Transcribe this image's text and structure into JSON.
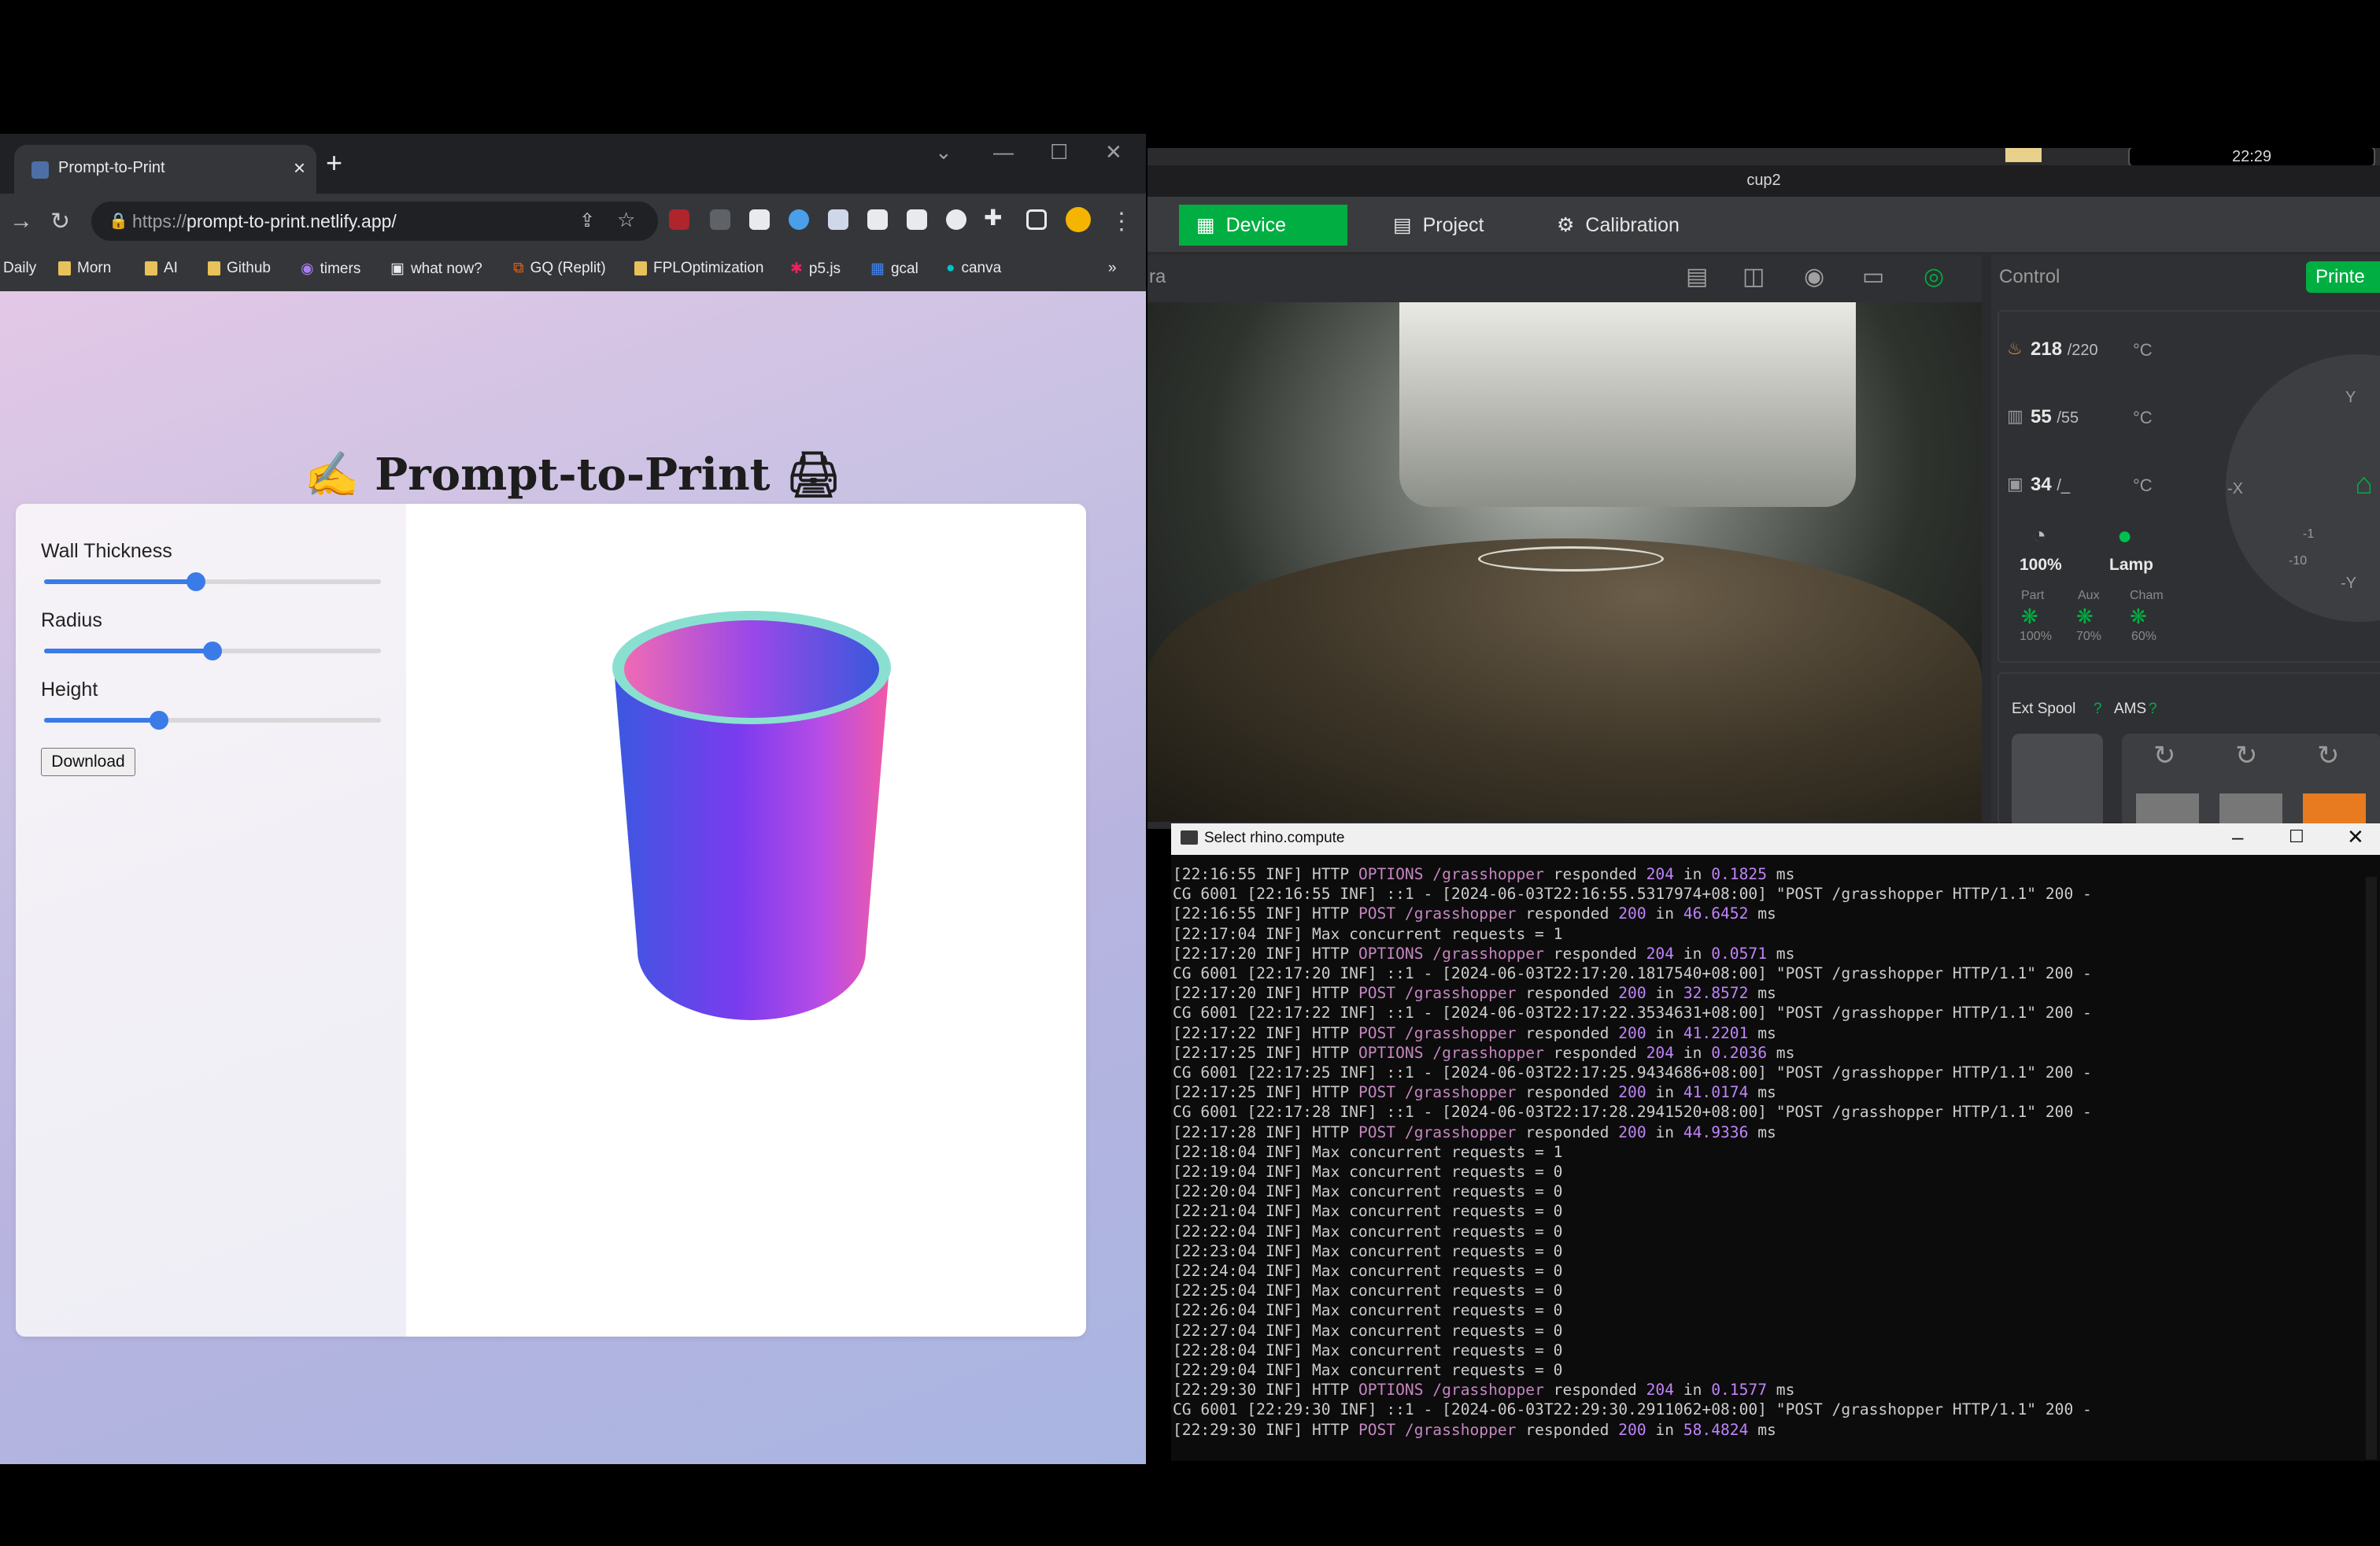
{
  "browser": {
    "tab_title": "Prompt-to-Print",
    "url_prefix": "https://",
    "url_host": "prompt-to-print.netlify.app/",
    "bookmarks": [
      {
        "label": "Daily"
      },
      {
        "label": "Morn"
      },
      {
        "label": "AI"
      },
      {
        "label": "Github"
      },
      {
        "label": "timers"
      },
      {
        "label": "what now?"
      },
      {
        "label": "GQ (Replit)"
      },
      {
        "label": "FPLOptimization"
      },
      {
        "label": "p5.js"
      },
      {
        "label": "gcal"
      },
      {
        "label": "canva"
      }
    ],
    "more": "»"
  },
  "app": {
    "title": "Prompt-to-Print",
    "title_icon_left": "✍",
    "title_icon_right": "🖨",
    "wall_thickness_label": "Wall Thickness",
    "wall_thickness_value": 0.45,
    "radius_label": "Radius",
    "radius_value": 0.5,
    "height_label": "Height",
    "height_value": 0.34,
    "download_label": "Download"
  },
  "bambu": {
    "window_title": "cup2",
    "clock": "22:29",
    "tabs": [
      {
        "label": "Device",
        "active": true
      },
      {
        "label": "Project",
        "active": false
      },
      {
        "label": "Calibration",
        "active": false
      }
    ],
    "camera_label": "ra",
    "control_label": "Control",
    "printer_button": "Printe",
    "nozzle_temp": "218",
    "nozzle_target": "/220",
    "bed_temp": "55",
    "bed_target": "/55",
    "chamber_temp": "34",
    "chamber_target": "/_",
    "temp_unit": "°C",
    "speed": "100%",
    "lamp": "Lamp",
    "fans": [
      {
        "label": "Part",
        "value": "100%"
      },
      {
        "label": "Aux",
        "value": "70%"
      },
      {
        "label": "Cham",
        "value": "60%"
      }
    ],
    "jog": {
      "y_plus": "Y",
      "x_minus": "-X",
      "y_minus": "-Y",
      "z": "-10",
      "z1": "-1"
    },
    "ext_spool": "Ext Spool",
    "ams": "AMS"
  },
  "terminal": {
    "title": "Select rhino.compute",
    "lines": [
      "[22:16:55 INF] HTTP |OPTIONS /grasshopper| responded |204| in |0.1825| ms",
      "CG 6001 [22:16:55 INF] ::1 - [2024-06-03T22:16:55.5317974+08:00] \"POST /grasshopper HTTP/1.1\" 200 -",
      "[22:16:55 INF] HTTP |POST /grasshopper| responded |200| in |46.6452| ms",
      "[22:17:04 INF] Max concurrent requests = 1",
      "[22:17:20 INF] HTTP |OPTIONS /grasshopper| responded |204| in |0.0571| ms",
      "CG 6001 [22:17:20 INF] ::1 - [2024-06-03T22:17:20.1817540+08:00] \"POST /grasshopper HTTP/1.1\" 200 -",
      "[22:17:20 INF] HTTP |POST /grasshopper| responded |200| in |32.8572| ms",
      "CG 6001 [22:17:22 INF] ::1 - [2024-06-03T22:17:22.3534631+08:00] \"POST /grasshopper HTTP/1.1\" 200 -",
      "[22:17:22 INF] HTTP |POST /grasshopper| responded |200| in |41.2201| ms",
      "[22:17:25 INF] HTTP |OPTIONS /grasshopper| responded |204| in |0.2036| ms",
      "CG 6001 [22:17:25 INF] ::1 - [2024-06-03T22:17:25.9434686+08:00] \"POST /grasshopper HTTP/1.1\" 200 -",
      "[22:17:25 INF] HTTP |POST /grasshopper| responded |200| in |41.0174| ms",
      "CG 6001 [22:17:28 INF] ::1 - [2024-06-03T22:17:28.2941520+08:00] \"POST /grasshopper HTTP/1.1\" 200 -",
      "[22:17:28 INF] HTTP |POST /grasshopper| responded |200| in |44.9336| ms",
      "[22:18:04 INF] Max concurrent requests = 1",
      "[22:19:04 INF] Max concurrent requests = 0",
      "[22:20:04 INF] Max concurrent requests = 0",
      "[22:21:04 INF] Max concurrent requests = 0",
      "[22:22:04 INF] Max concurrent requests = 0",
      "[22:23:04 INF] Max concurrent requests = 0",
      "[22:24:04 INF] Max concurrent requests = 0",
      "[22:25:04 INF] Max concurrent requests = 0",
      "[22:26:04 INF] Max concurrent requests = 0",
      "[22:27:04 INF] Max concurrent requests = 0",
      "[22:28:04 INF] Max concurrent requests = 0",
      "[22:29:04 INF] Max concurrent requests = 0",
      "[22:29:30 INF] HTTP |OPTIONS /grasshopper| responded |204| in |0.1577| ms",
      "CG 6001 [22:29:30 INF] ::1 - [2024-06-03T22:29:30.2911062+08:00] \"POST /grasshopper HTTP/1.1\" 200 -",
      "[22:29:30 INF] HTTP |POST /grasshopper| responded |200| in |58.4824| ms"
    ]
  }
}
